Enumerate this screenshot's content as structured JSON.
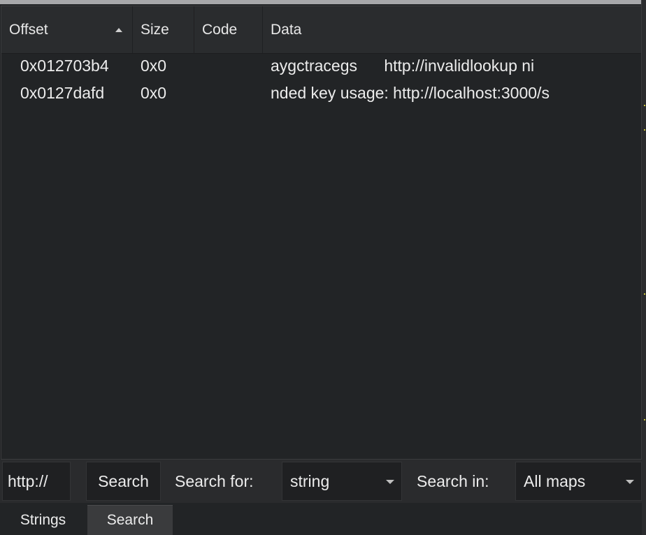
{
  "table": {
    "columns": {
      "offset": "Offset",
      "size": "Size",
      "code": "Code",
      "data": "Data"
    },
    "rows": [
      {
        "offset": "0x012703b4",
        "size": "0x0",
        "code": "",
        "data": "aygctracegs      http://invalidlookup ni"
      },
      {
        "offset": "0x0127dafd",
        "size": "0x0",
        "code": "",
        "data": "nded key usage: http://localhost:3000/s"
      }
    ]
  },
  "toolbar": {
    "query_value": "http://",
    "search_button": "Search",
    "search_for_label": "Search for:",
    "search_for_value": "string",
    "search_in_label": "Search in:",
    "search_in_value": "All maps"
  },
  "tabs": {
    "strings": "Strings",
    "search": "Search"
  },
  "colors": {
    "background": "#222426",
    "header": "#2a2c2e",
    "active_tab": "#3a3b3d",
    "text": "#ececec"
  }
}
